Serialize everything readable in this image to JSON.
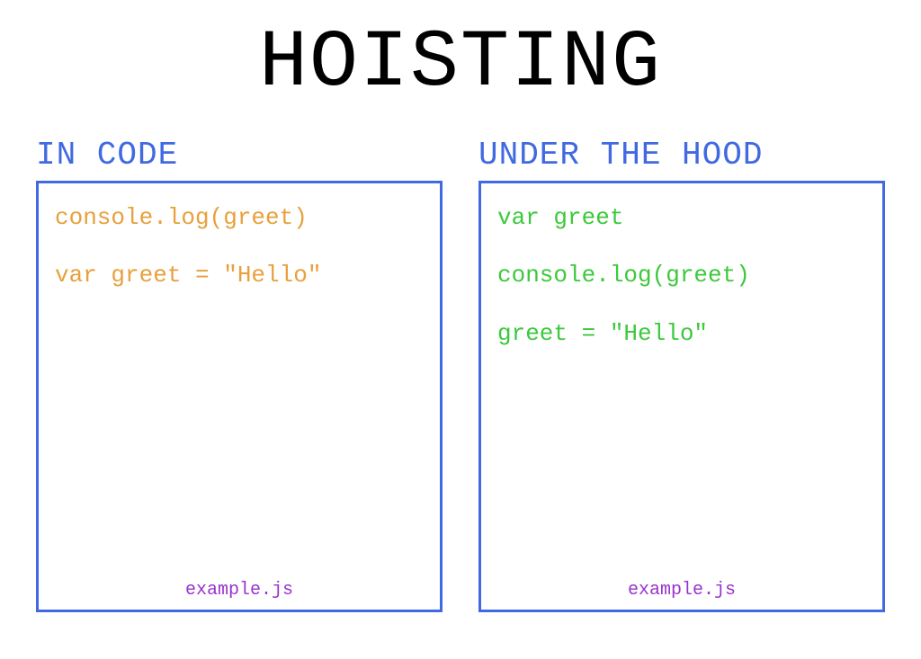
{
  "title": "HOISTING",
  "left": {
    "header": "IN CODE",
    "lines": [
      "console.log(greet)",
      "var greet = \"Hello\""
    ],
    "filename": "example.js"
  },
  "right": {
    "header": "UNDER THE HOOD",
    "lines": [
      "var greet",
      "console.log(greet)",
      "greet = \"Hello\""
    ],
    "filename": "example.js"
  }
}
